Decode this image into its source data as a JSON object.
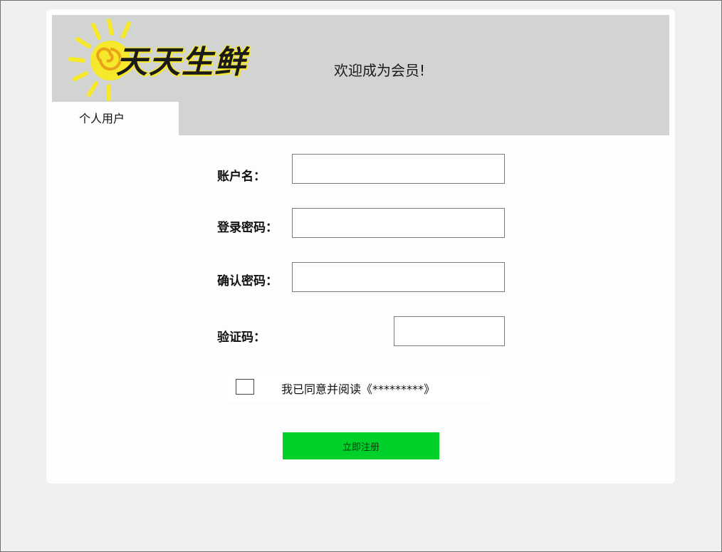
{
  "header": {
    "logo_text": "天天生鲜",
    "welcome": "欢迎成为会员!"
  },
  "tabs": [
    {
      "label": "个人用户",
      "active": true
    }
  ],
  "form": {
    "account": {
      "label": "账户名：",
      "value": "",
      "placeholder": ""
    },
    "password": {
      "label": "登录密码：",
      "value": "",
      "placeholder": ""
    },
    "confirm_password": {
      "label": "确认密码：",
      "value": "",
      "placeholder": ""
    },
    "captcha": {
      "label": "验证码：",
      "value": "",
      "placeholder": ""
    },
    "agreement": {
      "text": "我已同意并阅读《*********》",
      "checked": false
    },
    "submit_label": "立即注册"
  },
  "colors": {
    "header_bg": "#d2d4d1",
    "submit_bg": "#00d12a",
    "page_bg": "#efefef",
    "logo_sun": "#f6e82a"
  }
}
